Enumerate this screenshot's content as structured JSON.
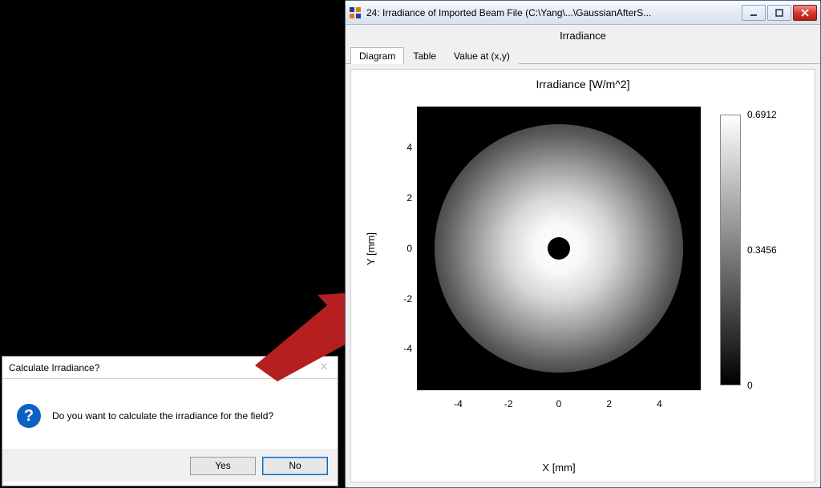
{
  "dialog": {
    "title": "Calculate Irradiance?",
    "message": "Do you want to calculate the irradiance for the field?",
    "icon_glyph": "?",
    "buttons": {
      "yes": "Yes",
      "no": "No"
    }
  },
  "window": {
    "title": "24: Irradiance of Imported Beam File (C:\\Yang\\...\\GaussianAfterS...",
    "doc_title": "Irradiance",
    "tabs": [
      {
        "label": "Diagram",
        "active": true
      },
      {
        "label": "Table",
        "active": false
      },
      {
        "label": "Value at (x,y)",
        "active": false
      }
    ]
  },
  "chart_data": {
    "type": "heatmap",
    "title": "Irradiance  [W/m^2]",
    "xlabel": "X [mm]",
    "ylabel": "Y [mm]",
    "xlim": [
      -5.5,
      5.5
    ],
    "ylim": [
      -5.5,
      5.5
    ],
    "xticks": [
      -4,
      -2,
      0,
      2,
      4
    ],
    "yticks": [
      -4,
      -2,
      0,
      2,
      4
    ],
    "colorbar": {
      "min": 0,
      "max": 0.6912,
      "ticks": [
        0,
        0.3456,
        0.6912
      ],
      "colormap": "grayscale"
    },
    "beam": {
      "profile": "gaussian",
      "center_mm": [
        0,
        0
      ],
      "approx_1e2_radius_mm": 4.8,
      "obscuration_radius_mm": 0.4,
      "peak_value": 0.6912,
      "background_value": 0
    }
  }
}
